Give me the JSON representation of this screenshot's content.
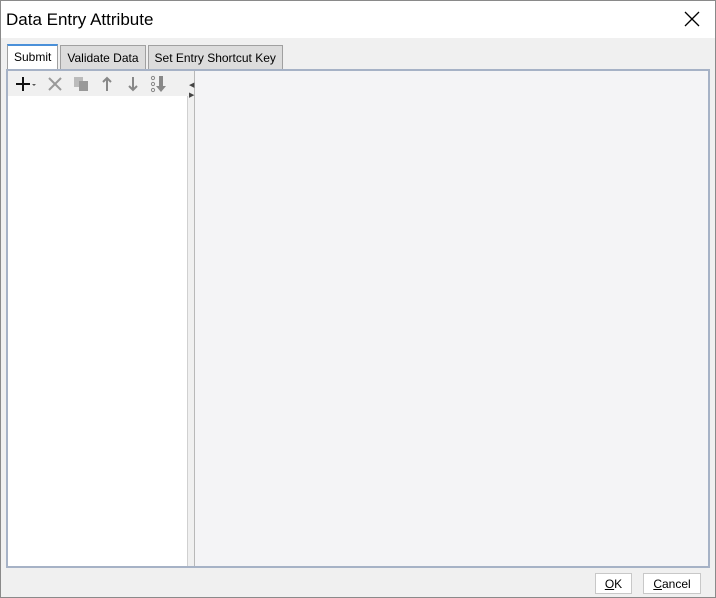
{
  "window": {
    "title": "Data Entry Attribute"
  },
  "tabs": [
    {
      "label": "Submit",
      "active": true
    },
    {
      "label": "Validate Data"
    },
    {
      "label": "Set Entry Shortcut Key"
    }
  ],
  "toolbar": {
    "icons": [
      "add-icon",
      "delete-icon",
      "copy-icon",
      "move-up-icon",
      "move-down-icon",
      "sort-icon"
    ]
  },
  "footer": {
    "ok_key": "O",
    "ok_rest": "K",
    "cancel_key": "C",
    "cancel_rest": "ancel"
  }
}
